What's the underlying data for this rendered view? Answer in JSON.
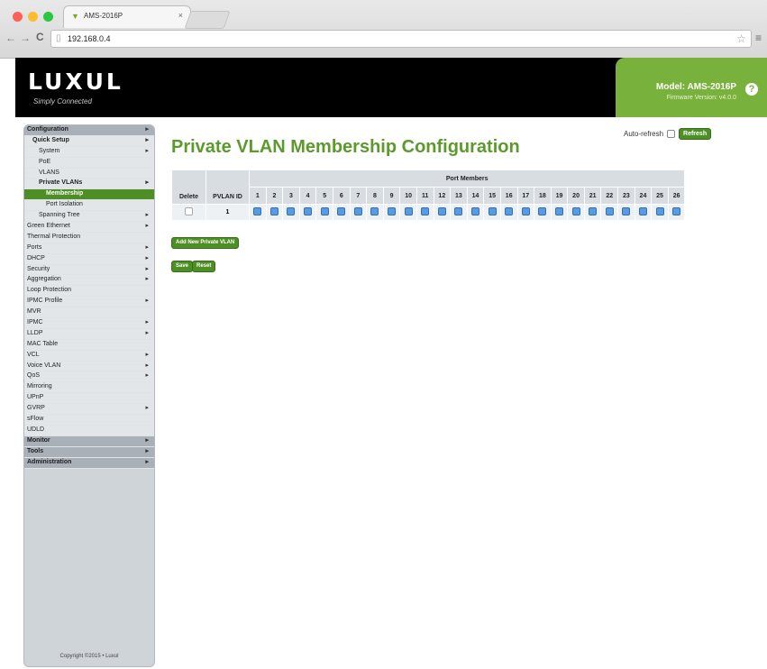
{
  "browser": {
    "tab_title": "AMS-2016P",
    "tab_close": "×",
    "url": "192.168.0.4",
    "back": "←",
    "forward": "→",
    "reload": "C",
    "colors": {
      "close": "#ff5f57",
      "minimize": "#febc2e",
      "maximize": "#28c840"
    }
  },
  "header": {
    "logo": "LUXUL",
    "tagline": "Simply Connected",
    "model": "Model: AMS-2016P",
    "firmware": "Firmware Version: v4.0.0",
    "accent": "#79b13d"
  },
  "sidebar": {
    "items": [
      {
        "label": "Configuration",
        "level": 0,
        "style": "section",
        "arrow": true
      },
      {
        "label": "Quick Setup",
        "level": 1,
        "style": "bold",
        "arrow": true
      },
      {
        "label": "System",
        "level": 2,
        "style": "",
        "arrow": true
      },
      {
        "label": "PoE",
        "level": 2,
        "style": "",
        "arrow": false
      },
      {
        "label": "VLANS",
        "level": 2,
        "style": "",
        "arrow": false
      },
      {
        "label": "Private VLANs",
        "level": 2,
        "style": "bold",
        "arrow": true
      },
      {
        "label": "Membership",
        "level": 3,
        "style": "active",
        "arrow": false
      },
      {
        "label": "Port Isolation",
        "level": 3,
        "style": "",
        "arrow": false
      },
      {
        "label": "Spanning Tree",
        "level": 2,
        "style": "",
        "arrow": true
      },
      {
        "label": "Green Ethernet",
        "level": 0,
        "style": "",
        "arrow": true
      },
      {
        "label": "Thermal Protection",
        "level": 0,
        "style": "",
        "arrow": false
      },
      {
        "label": "Ports",
        "level": 0,
        "style": "",
        "arrow": true
      },
      {
        "label": "DHCP",
        "level": 0,
        "style": "",
        "arrow": true
      },
      {
        "label": "Security",
        "level": 0,
        "style": "",
        "arrow": true
      },
      {
        "label": "Aggregation",
        "level": 0,
        "style": "",
        "arrow": true
      },
      {
        "label": "Loop Protection",
        "level": 0,
        "style": "",
        "arrow": false
      },
      {
        "label": "IPMC Profile",
        "level": 0,
        "style": "",
        "arrow": true
      },
      {
        "label": "MVR",
        "level": 0,
        "style": "",
        "arrow": false
      },
      {
        "label": "IPMC",
        "level": 0,
        "style": "",
        "arrow": true
      },
      {
        "label": "LLDP",
        "level": 0,
        "style": "",
        "arrow": true
      },
      {
        "label": "MAC Table",
        "level": 0,
        "style": "",
        "arrow": false
      },
      {
        "label": "VCL",
        "level": 0,
        "style": "",
        "arrow": true
      },
      {
        "label": "Voice VLAN",
        "level": 0,
        "style": "",
        "arrow": true
      },
      {
        "label": "QoS",
        "level": 0,
        "style": "",
        "arrow": true
      },
      {
        "label": "Mirroring",
        "level": 0,
        "style": "",
        "arrow": false
      },
      {
        "label": "UPnP",
        "level": 0,
        "style": "",
        "arrow": false
      },
      {
        "label": "GVRP",
        "level": 0,
        "style": "",
        "arrow": true
      },
      {
        "label": "sFlow",
        "level": 0,
        "style": "",
        "arrow": false
      },
      {
        "label": "UDLD",
        "level": 0,
        "style": "",
        "arrow": false
      },
      {
        "label": "Monitor",
        "level": 0,
        "style": "section",
        "arrow": true
      },
      {
        "label": "Tools",
        "level": 0,
        "style": "section",
        "arrow": true
      },
      {
        "label": "Administration",
        "level": 0,
        "style": "section",
        "arrow": true
      }
    ],
    "copyright": "Copyright ©2015 • Luxul"
  },
  "main": {
    "title": "Private VLAN Membership Configuration",
    "auto_refresh_label": "Auto-refresh",
    "refresh_label": "Refresh",
    "table": {
      "col_delete": "Delete",
      "col_pvlan": "PVLAN ID",
      "port_members_label": "Port Members",
      "ports": [
        "1",
        "2",
        "3",
        "4",
        "5",
        "6",
        "7",
        "8",
        "9",
        "10",
        "11",
        "12",
        "13",
        "14",
        "15",
        "16",
        "17",
        "18",
        "19",
        "20",
        "21",
        "22",
        "23",
        "24",
        "25",
        "26"
      ],
      "rows": [
        {
          "pvlan_id": "1",
          "delete": false,
          "members": [
            true,
            true,
            true,
            true,
            true,
            true,
            true,
            true,
            true,
            true,
            true,
            true,
            true,
            true,
            true,
            true,
            true,
            true,
            true,
            true,
            true,
            true,
            true,
            true,
            true,
            true
          ]
        }
      ]
    },
    "add_label": "Add New Private VLAN",
    "save_label": "Save",
    "reset_label": "Reset"
  }
}
